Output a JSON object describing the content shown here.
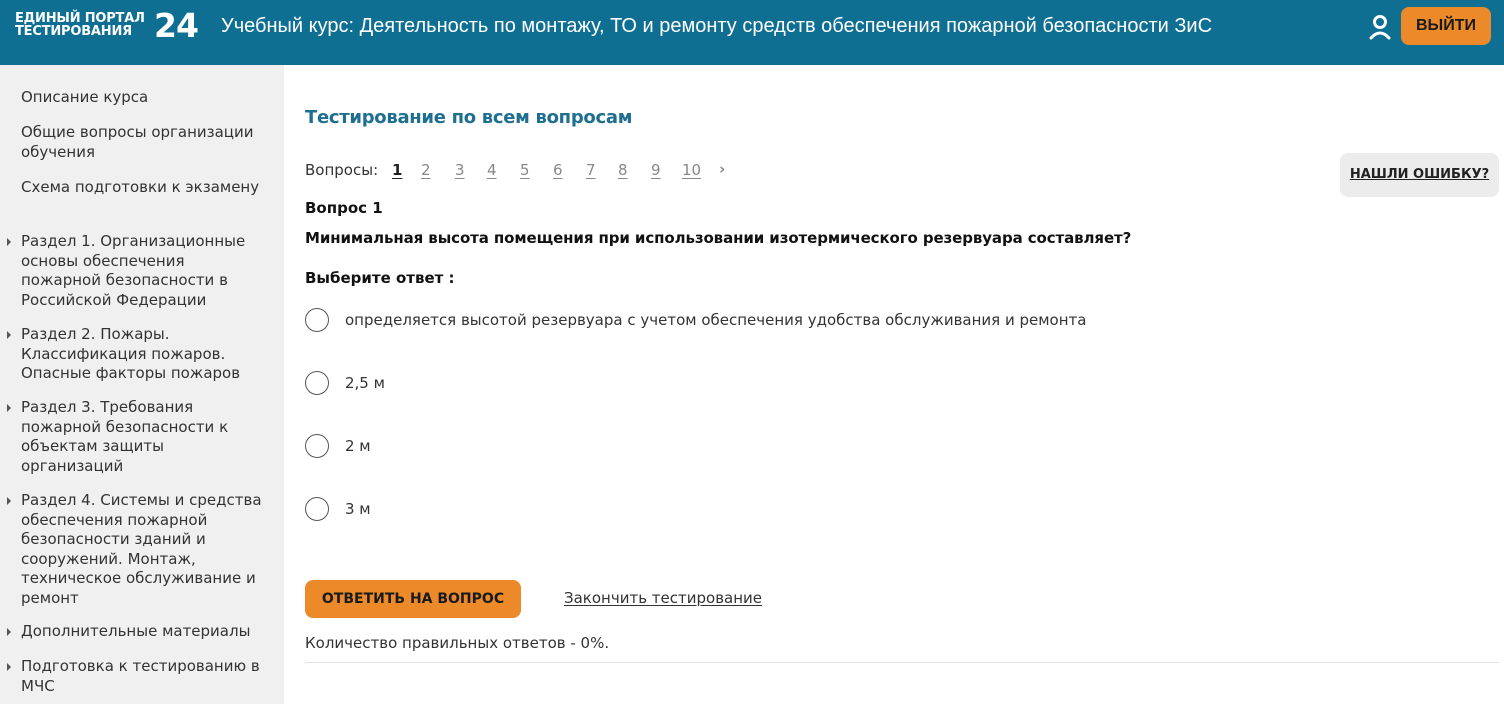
{
  "header": {
    "logo_line1": "ЕДИНЫЙ ПОРТАЛ",
    "logo_line2": "ТЕСТИРОВАНИЯ",
    "logo_number": "24",
    "course_title": "Учебный курс: Деятельность по монтажу, ТО и ремонту средств обеспечения пожарной безопасности ЗиС",
    "logout_label": "ВЫЙТИ",
    "icons": [
      "user-icon"
    ],
    "colors": {
      "header_bg": "#0e6f93",
      "accent": "#ec8a2a"
    }
  },
  "sidebar": {
    "items": [
      {
        "label": "Описание курса",
        "has_arrow": false
      },
      {
        "label": "Общие вопросы организации обучения",
        "has_arrow": false
      },
      {
        "label": "Схема подготовки к экзамену",
        "has_arrow": false
      },
      {
        "label": "Раздел 1. Организационные основы обеспечения пожарной безопасности в Российской Федерации",
        "has_arrow": true
      },
      {
        "label": "Раздел 2. Пожары. Классификация пожаров. Опасные факторы пожаров",
        "has_arrow": true
      },
      {
        "label": "Раздел 3. Требования пожарной безопасности к объектам защиты организаций",
        "has_arrow": true
      },
      {
        "label": "Раздел 4. Системы и средства обеспечения пожарной безопасности зданий и сооружений. Монтаж, техническое обслуживание и ремонт",
        "has_arrow": true
      },
      {
        "label": "Дополнительные материалы",
        "has_arrow": true
      },
      {
        "label": "Подготовка к тестированию в МЧС",
        "has_arrow": true
      }
    ]
  },
  "main": {
    "title": "Тестирование по всем вопросам",
    "questions_label": "Вопросы:",
    "question_links": [
      "1",
      "2",
      "3",
      "4",
      "5",
      "6",
      "7",
      "8",
      "9",
      "10"
    ],
    "active_question": "1",
    "next_symbol": "›",
    "report_error_label": "НАШЛИ ОШИБКУ?",
    "question_number": "Вопрос 1",
    "question_text": "Минимальная высота помещения при использовании изотермического резервуара составляет?",
    "choose_label": "Выберите ответ :",
    "options": [
      "определяется высотой резервуара с учетом обеспечения удобства обслуживания и ремонта",
      "2,5 м",
      "2 м",
      "3 м"
    ],
    "answer_button": "ОТВЕТИТЬ НА ВОПРОС",
    "finish_link": "Закончить тестирование",
    "result_text": "Количество правильных ответов - 0%."
  }
}
